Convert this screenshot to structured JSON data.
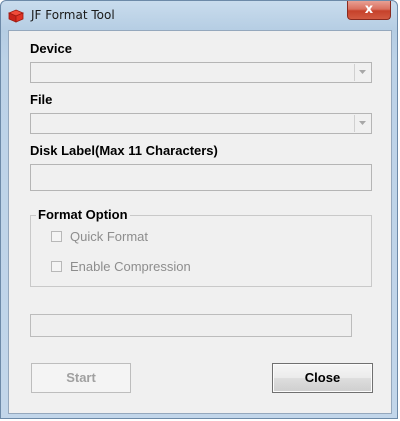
{
  "window": {
    "title": "JF Format Tool",
    "close_glyph": "x"
  },
  "fields": {
    "device_label": "Device",
    "device_value": "",
    "file_label": "File",
    "file_value": "",
    "disk_label_label": "Disk Label(Max 11 Characters)",
    "disk_label_value": ""
  },
  "format_option": {
    "title": "Format Option",
    "quick_format_label": "Quick Format",
    "quick_format_checked": false,
    "enable_compression_label": "Enable Compression",
    "enable_compression_checked": false
  },
  "progress": {
    "value": 0
  },
  "buttons": {
    "start_label": "Start",
    "close_label": "Close"
  },
  "colors": {
    "title_bar": "#bcd2e7",
    "client_bg": "#f0f0f0",
    "close_button": "#c6412b",
    "disabled_text": "#8d8d8d"
  },
  "icons": {
    "app": "red-cube-icon",
    "dropdown": "chevron-down-icon"
  }
}
